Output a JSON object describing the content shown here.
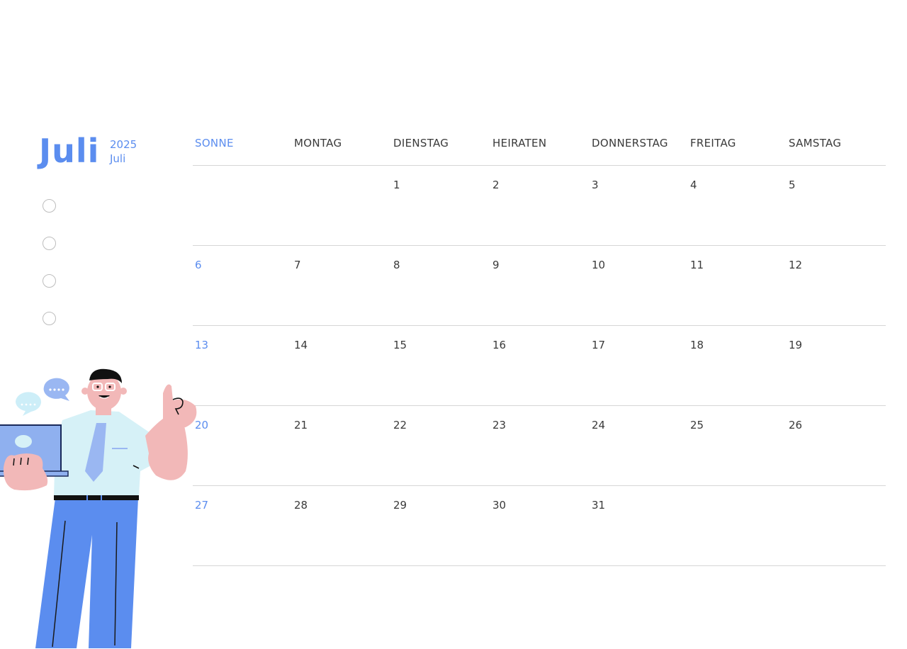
{
  "colors": {
    "accent": "#5b8def",
    "text": "#3a3a3a",
    "line": "#d6d6d6"
  },
  "header": {
    "month": "Juli",
    "year": "2025",
    "month_small": "Juli"
  },
  "weekdays": [
    "SONNE",
    "MONTAG",
    "DIENSTAG",
    "HEIRATEN",
    "DONNERSTAG",
    "FREITAG",
    "SAMSTAG"
  ],
  "weeks": [
    [
      "",
      "",
      "1",
      "2",
      "3",
      "4",
      "5"
    ],
    [
      "6",
      "7",
      "8",
      "9",
      "10",
      "11",
      "12"
    ],
    [
      "13",
      "14",
      "15",
      "16",
      "17",
      "18",
      "19"
    ],
    [
      "20",
      "21",
      "22",
      "23",
      "24",
      "25",
      "26"
    ],
    [
      "27",
      "28",
      "29",
      "30",
      "31",
      "",
      ""
    ]
  ],
  "illustration": {
    "icon": "man-with-laptop-illustration"
  }
}
